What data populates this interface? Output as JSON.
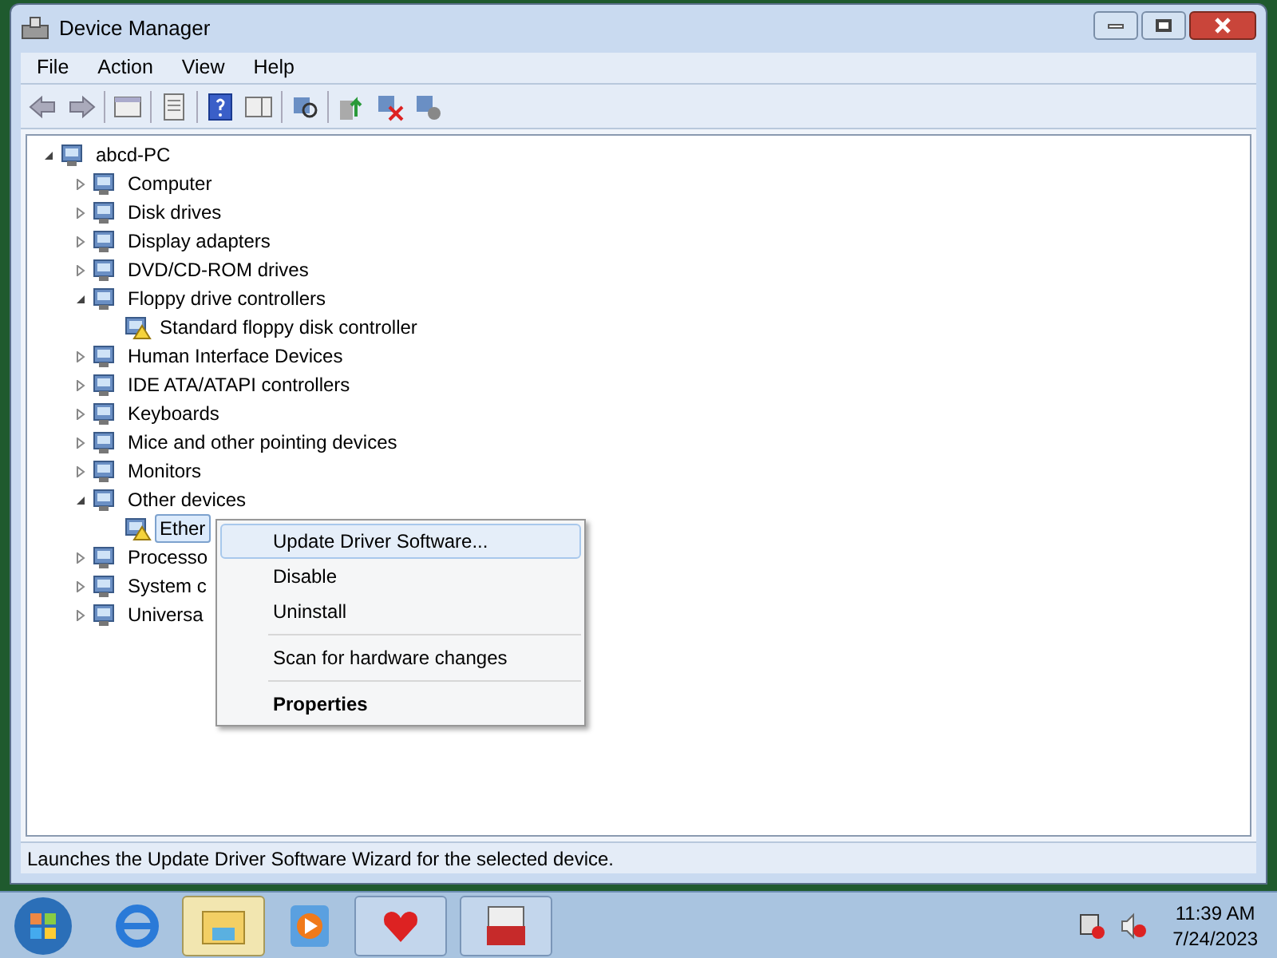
{
  "window": {
    "title": "Device Manager"
  },
  "menu_bar": [
    "File",
    "Action",
    "View",
    "Help"
  ],
  "tree": [
    {
      "label": "abcd-PC",
      "expanded": true,
      "selected": false,
      "children": [
        {
          "label": "Computer",
          "expanded": false,
          "selected": false
        },
        {
          "label": "Disk drives",
          "expanded": false,
          "selected": false
        },
        {
          "label": "Display adapters",
          "expanded": false,
          "selected": false
        },
        {
          "label": "DVD/CD-ROM drives",
          "expanded": false,
          "selected": false
        },
        {
          "label": "Floppy drive controllers",
          "expanded": true,
          "selected": false,
          "children": [
            {
              "label": "Standard floppy disk controller",
              "warning": true,
              "selected": false
            }
          ]
        },
        {
          "label": "Human Interface Devices",
          "expanded": false,
          "selected": false
        },
        {
          "label": "IDE ATA/ATAPI controllers",
          "expanded": false,
          "selected": false
        },
        {
          "label": "Keyboards",
          "expanded": false,
          "selected": false
        },
        {
          "label": "Mice and other pointing devices",
          "expanded": false,
          "selected": false
        },
        {
          "label": "Monitors",
          "expanded": false,
          "selected": false
        },
        {
          "label": "Other devices",
          "expanded": true,
          "selected": false,
          "children": [
            {
              "label": "Ether",
              "warning": true,
              "selected": true
            }
          ]
        },
        {
          "label": "Processo",
          "expanded": false,
          "selected": false
        },
        {
          "label": "System c",
          "expanded": false,
          "selected": false
        },
        {
          "label": "Universa",
          "expanded": false,
          "selected": false
        }
      ]
    }
  ],
  "context_menu": [
    {
      "kind": "item",
      "label": "Update Driver Software...",
      "selected": true,
      "bold": false
    },
    {
      "kind": "item",
      "label": "Disable",
      "selected": false,
      "bold": false
    },
    {
      "kind": "item",
      "label": "Uninstall",
      "selected": false,
      "bold": false
    },
    {
      "kind": "separator"
    },
    {
      "kind": "item",
      "label": "Scan for hardware changes",
      "selected": false,
      "bold": false
    },
    {
      "kind": "separator"
    },
    {
      "kind": "item",
      "label": "Properties",
      "selected": false,
      "bold": true
    }
  ],
  "status_bar": "Launches the Update Driver Software Wizard for the selected device.",
  "taskbar": {
    "time": "11:39 AM",
    "date": "7/24/2023"
  }
}
